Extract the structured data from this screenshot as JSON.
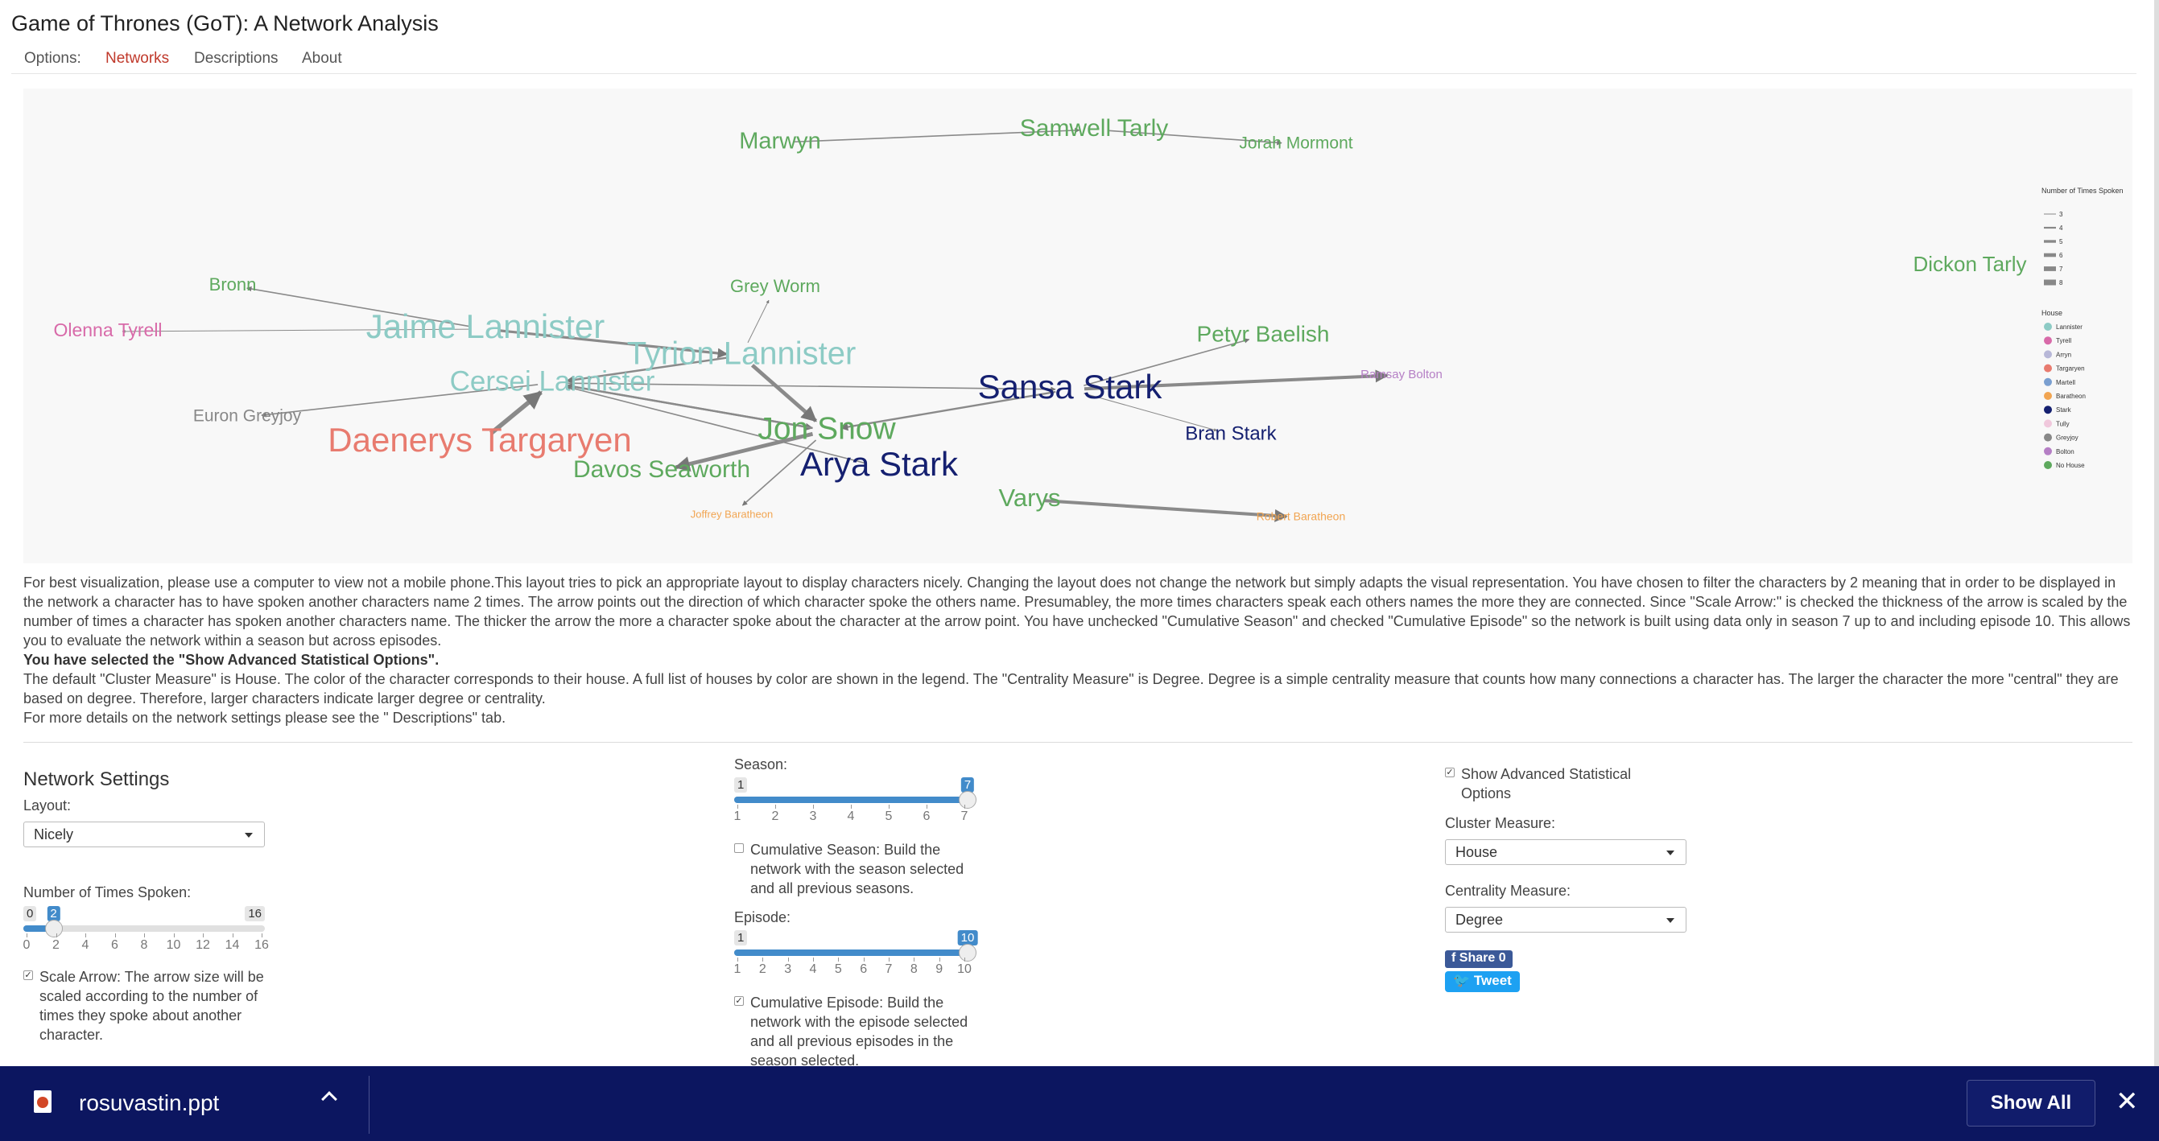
{
  "title": "Game of Thrones (GoT): A Network Analysis",
  "nav": {
    "options": "Options:",
    "networks": "Networks",
    "descriptions": "Descriptions",
    "about": "About"
  },
  "network": {
    "nodes": [
      {
        "id": "marwyn",
        "label": "Marwyn",
        "color": "#5ea95e"
      },
      {
        "id": "samwell",
        "label": "Samwell Tarly",
        "color": "#5ea95e"
      },
      {
        "id": "jorah",
        "label": "Jorah Mormont",
        "color": "#5ea95e"
      },
      {
        "id": "dickon",
        "label": "Dickon Tarly",
        "color": "#5ea95e"
      },
      {
        "id": "bronn",
        "label": "Bronn",
        "color": "#5ea95e"
      },
      {
        "id": "greyworm",
        "label": "Grey Worm",
        "color": "#5ea95e"
      },
      {
        "id": "olenna",
        "label": "Olenna Tyrell",
        "color": "#d86aa9"
      },
      {
        "id": "jaime",
        "label": "Jaime Lannister",
        "color": "#8dcbc5"
      },
      {
        "id": "tyrion",
        "label": "Tyrion Lannister",
        "color": "#8dcbc5"
      },
      {
        "id": "cersei",
        "label": "Cersei Lannister",
        "color": "#8dcbc5"
      },
      {
        "id": "petyr",
        "label": "Petyr Baelish",
        "color": "#5ea95e"
      },
      {
        "id": "sansa",
        "label": "Sansa Stark",
        "color": "#152070"
      },
      {
        "id": "ramsay",
        "label": "Ramsay Bolton",
        "color": "#b57fc5"
      },
      {
        "id": "euron",
        "label": "Euron Greyjoy",
        "color": "#888888"
      },
      {
        "id": "daenerys",
        "label": "Daenerys Targaryen",
        "color": "#e87b6f"
      },
      {
        "id": "jon",
        "label": "Jon Snow",
        "color": "#5ea95e"
      },
      {
        "id": "bran",
        "label": "Bran Stark",
        "color": "#152070"
      },
      {
        "id": "davos",
        "label": "Davos Seaworth",
        "color": "#5ea95e"
      },
      {
        "id": "arya",
        "label": "Arya Stark",
        "color": "#152070"
      },
      {
        "id": "varys",
        "label": "Varys",
        "color": "#5ea95e"
      },
      {
        "id": "joffrey",
        "label": "Joffrey Baratheon",
        "color": "#f1a552"
      },
      {
        "id": "robert",
        "label": "Robert Baratheon",
        "color": "#f1a552"
      }
    ],
    "edges": [
      {
        "from": "marwyn",
        "to": "samwell",
        "weight": 3
      },
      {
        "from": "samwell",
        "to": "jorah",
        "weight": 3
      },
      {
        "from": "jaime",
        "to": "bronn",
        "weight": 3
      },
      {
        "from": "jaime",
        "to": "olenna",
        "weight": 2
      },
      {
        "from": "jaime",
        "to": "tyrion",
        "weight": 5
      },
      {
        "from": "tyrion",
        "to": "greyworm",
        "weight": 2
      },
      {
        "from": "tyrion",
        "to": "cersei",
        "weight": 4
      },
      {
        "from": "tyrion",
        "to": "jon",
        "weight": 7
      },
      {
        "from": "cersei",
        "to": "euron",
        "weight": 3
      },
      {
        "from": "cersei",
        "to": "jon",
        "weight": 4
      },
      {
        "from": "cersei",
        "to": "sansa",
        "weight": 3
      },
      {
        "from": "daenerys",
        "to": "cersei",
        "weight": 8
      },
      {
        "from": "jon",
        "to": "davos",
        "weight": 7
      },
      {
        "from": "jon",
        "to": "joffrey",
        "weight": 3
      },
      {
        "from": "jon",
        "to": "cersei",
        "weight": 4
      },
      {
        "from": "sansa",
        "to": "petyr",
        "weight": 3
      },
      {
        "from": "sansa",
        "to": "ramsay",
        "weight": 6
      },
      {
        "from": "sansa",
        "to": "bran",
        "weight": 2
      },
      {
        "from": "sansa",
        "to": "jon",
        "weight": 4
      },
      {
        "from": "arya",
        "to": "cersei",
        "weight": 3
      },
      {
        "from": "varys",
        "to": "robert",
        "weight": 6
      }
    ]
  },
  "legend": {
    "arrow_title": "Number of Times Spoken",
    "arrow_values": [
      "3",
      "4",
      "5",
      "6",
      "7",
      "8"
    ],
    "house_title": "House",
    "houses": [
      {
        "label": "Lannister",
        "color": "#8dcbc5"
      },
      {
        "label": "Tyrell",
        "color": "#d86aa9"
      },
      {
        "label": "Arryn",
        "color": "#b8b8d8"
      },
      {
        "label": "Targaryen",
        "color": "#e87b6f"
      },
      {
        "label": "Martell",
        "color": "#7a9fd0"
      },
      {
        "label": "Baratheon",
        "color": "#f1a552"
      },
      {
        "label": "Stark",
        "color": "#152070"
      },
      {
        "label": "Tully",
        "color": "#f0c8dc"
      },
      {
        "label": "Greyjoy",
        "color": "#888888"
      },
      {
        "label": "Bolton",
        "color": "#b57fc5"
      },
      {
        "label": "No House",
        "color": "#5ea95e"
      }
    ]
  },
  "description": {
    "para1": "For best visualization, please use a computer to view not a mobile phone.This layout tries to pick an appropriate layout to display characters nicely. Changing the layout does not change the network but simply adapts the visual representation. You have chosen to filter the characters by 2 meaning that in order to be displayed in the network a character has to have spoken another characters name 2 times. The arrow points out the direction of which character spoke the others name. Presumabley, the more times characters speak each others names the more they are connected. Since \"Scale Arrow:\" is checked the thickness of the arrow is scaled by the number of times a character has spoken another characters name. The thicker the arrow the more a character spoke about the character at the arrow point. You have unchecked \"Cumulative Season\" and checked \"Cumulative Episode\" so the network is built using data only in season 7 up to and including episode 10. This allows you to evaluate the network within a season but across episodes.",
    "bold": "You have selected the \"Show Advanced Statistical Options\".",
    "para2": "The default \"Cluster Measure\" is House. The color of the character corresponds to their house. A full list of houses by color are shown in the legend. The \"Centrality Measure\" is Degree. Degree is a simple centrality measure that counts how many connections a character has. The larger the character the more \"central\" they are based on degree. Therefore, larger characters indicate larger degree or centrality.",
    "para3": "For more details on the network settings please see the \" Descriptions\" tab."
  },
  "settings": {
    "title": "Network Settings",
    "layout_label": "Layout:",
    "layout_value": "Nicely",
    "times_label": "Number of Times Spoken:",
    "times": {
      "min": 0,
      "max": 16,
      "value": 2,
      "min_text": "0",
      "max_text": "16",
      "value_text": "2",
      "ticks": [
        "0",
        "2",
        "4",
        "6",
        "8",
        "10",
        "12",
        "14",
        "16"
      ]
    },
    "scale_arrow": {
      "checked": true,
      "text": "Scale Arrow: The arrow size will be scaled according to the number of times they spoke about another character."
    },
    "season_label": "Season:",
    "season": {
      "min": 1,
      "max": 7,
      "value": 7,
      "min_text": "1",
      "value_text": "7",
      "ticks": [
        "1",
        "2",
        "3",
        "4",
        "5",
        "6",
        "7"
      ]
    },
    "cumulative_season": {
      "checked": false,
      "text": "Cumulative Season: Build the network with the season selected and all previous seasons."
    },
    "episode_label": "Episode:",
    "episode": {
      "min": 1,
      "max": 10,
      "value": 10,
      "min_text": "1",
      "value_text": "10",
      "ticks": [
        "1",
        "2",
        "3",
        "4",
        "5",
        "6",
        "7",
        "8",
        "9",
        "10"
      ]
    },
    "cumulative_episode": {
      "checked": true,
      "text": "Cumulative Episode: Build the network with the episode selected and all previous episodes in the season selected."
    },
    "advanced": {
      "checked": true,
      "text": "Show Advanced Statistical Options"
    },
    "cluster_label": "Cluster Measure:",
    "cluster_value": "House",
    "centrality_label": "Centrality Measure:",
    "centrality_value": "Degree",
    "share_label": "Share 0",
    "tweet_label": "Tweet"
  },
  "download": {
    "file": "rosuvastin.ppt",
    "show_all": "Show All",
    "close": "✕"
  },
  "colors": {
    "accent": "#428bca",
    "active_tab": "#c0392b",
    "download_bar": "#0c1660"
  }
}
